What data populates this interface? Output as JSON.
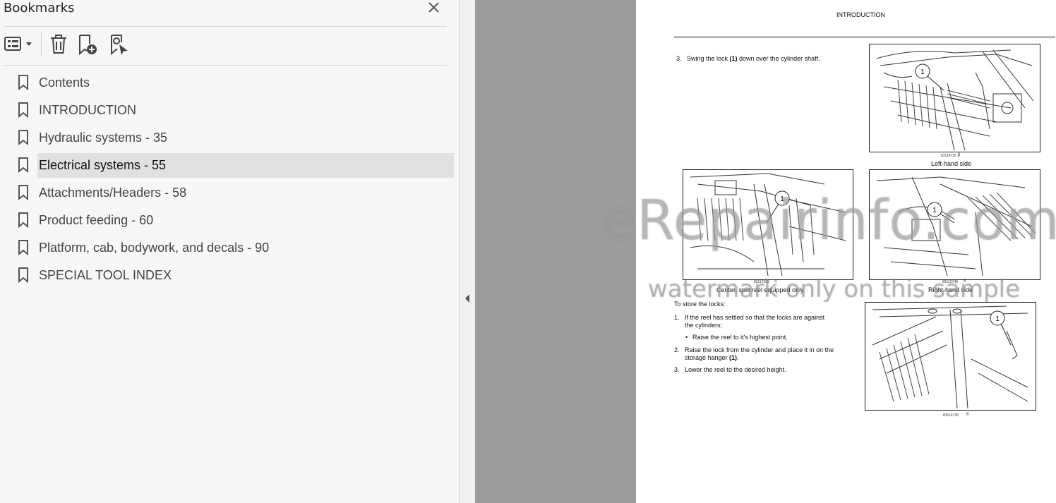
{
  "bookmarks_panel": {
    "title": "Bookmarks",
    "items": [
      {
        "label": "Contents"
      },
      {
        "label": "INTRODUCTION"
      },
      {
        "label": "Hydraulic systems - 35"
      },
      {
        "label": "Electrical systems - 55",
        "selected": true
      },
      {
        "label": "Attachments/Headers - 58"
      },
      {
        "label": "Product feeding - 60"
      },
      {
        "label": "Platform, cab, bodywork, and decals - 90"
      },
      {
        "label": "SPECIAL TOOL INDEX"
      }
    ]
  },
  "icons": {
    "close": "close-icon",
    "options": "options-list-icon",
    "delete": "trash-icon",
    "new_bookmark": "add-bookmark-icon",
    "find_bookmark": "find-bookmark-icon",
    "bookmark": "bookmark-icon",
    "collapse": "collapse-left-icon"
  },
  "colors": {
    "panel_bg": "#f7f7f7",
    "selected_bg": "#e1e1e1",
    "viewer_bg": "#9c9c9c"
  },
  "page": {
    "header": "INTRODUCTION",
    "step3_num": "3.",
    "step3_a": "Swing the lock ",
    "step3_b": "(1)",
    "step3_c": " down over the cylinder shaft.",
    "fig3_code": "83114735 1",
    "fig3_num": "3",
    "fig3_caption": "Left-hand side",
    "fig4_code": "83117056",
    "fig4_num": "4",
    "fig4_caption": "Center, split reel equipped only",
    "fig5_code": "83112748",
    "fig5_num": "5",
    "fig5_caption": "Right-hand side",
    "callout": "1",
    "store_heading": "To store the locks:",
    "s1_num": "1.",
    "s1_line1": "If the reel has settled so that the locks are against",
    "s1_line2": "the cylinders;",
    "bullet": "Raise the reel to it's highest point.",
    "s2_num": "2.",
    "s2_line1": "Raise the lock from the cylinder and place it in on the",
    "s2_line2a": "storage hanger ",
    "s2_line2b": "(1)",
    "s2_line2c": ".",
    "s3_num": "3.",
    "s3_text": "Lower the reel to the desired height.",
    "fig6_code": "83114738",
    "fig6_num": "6"
  },
  "watermark": {
    "line1": "eRepairinfo.com",
    "line2": "watermark only on this sample"
  }
}
